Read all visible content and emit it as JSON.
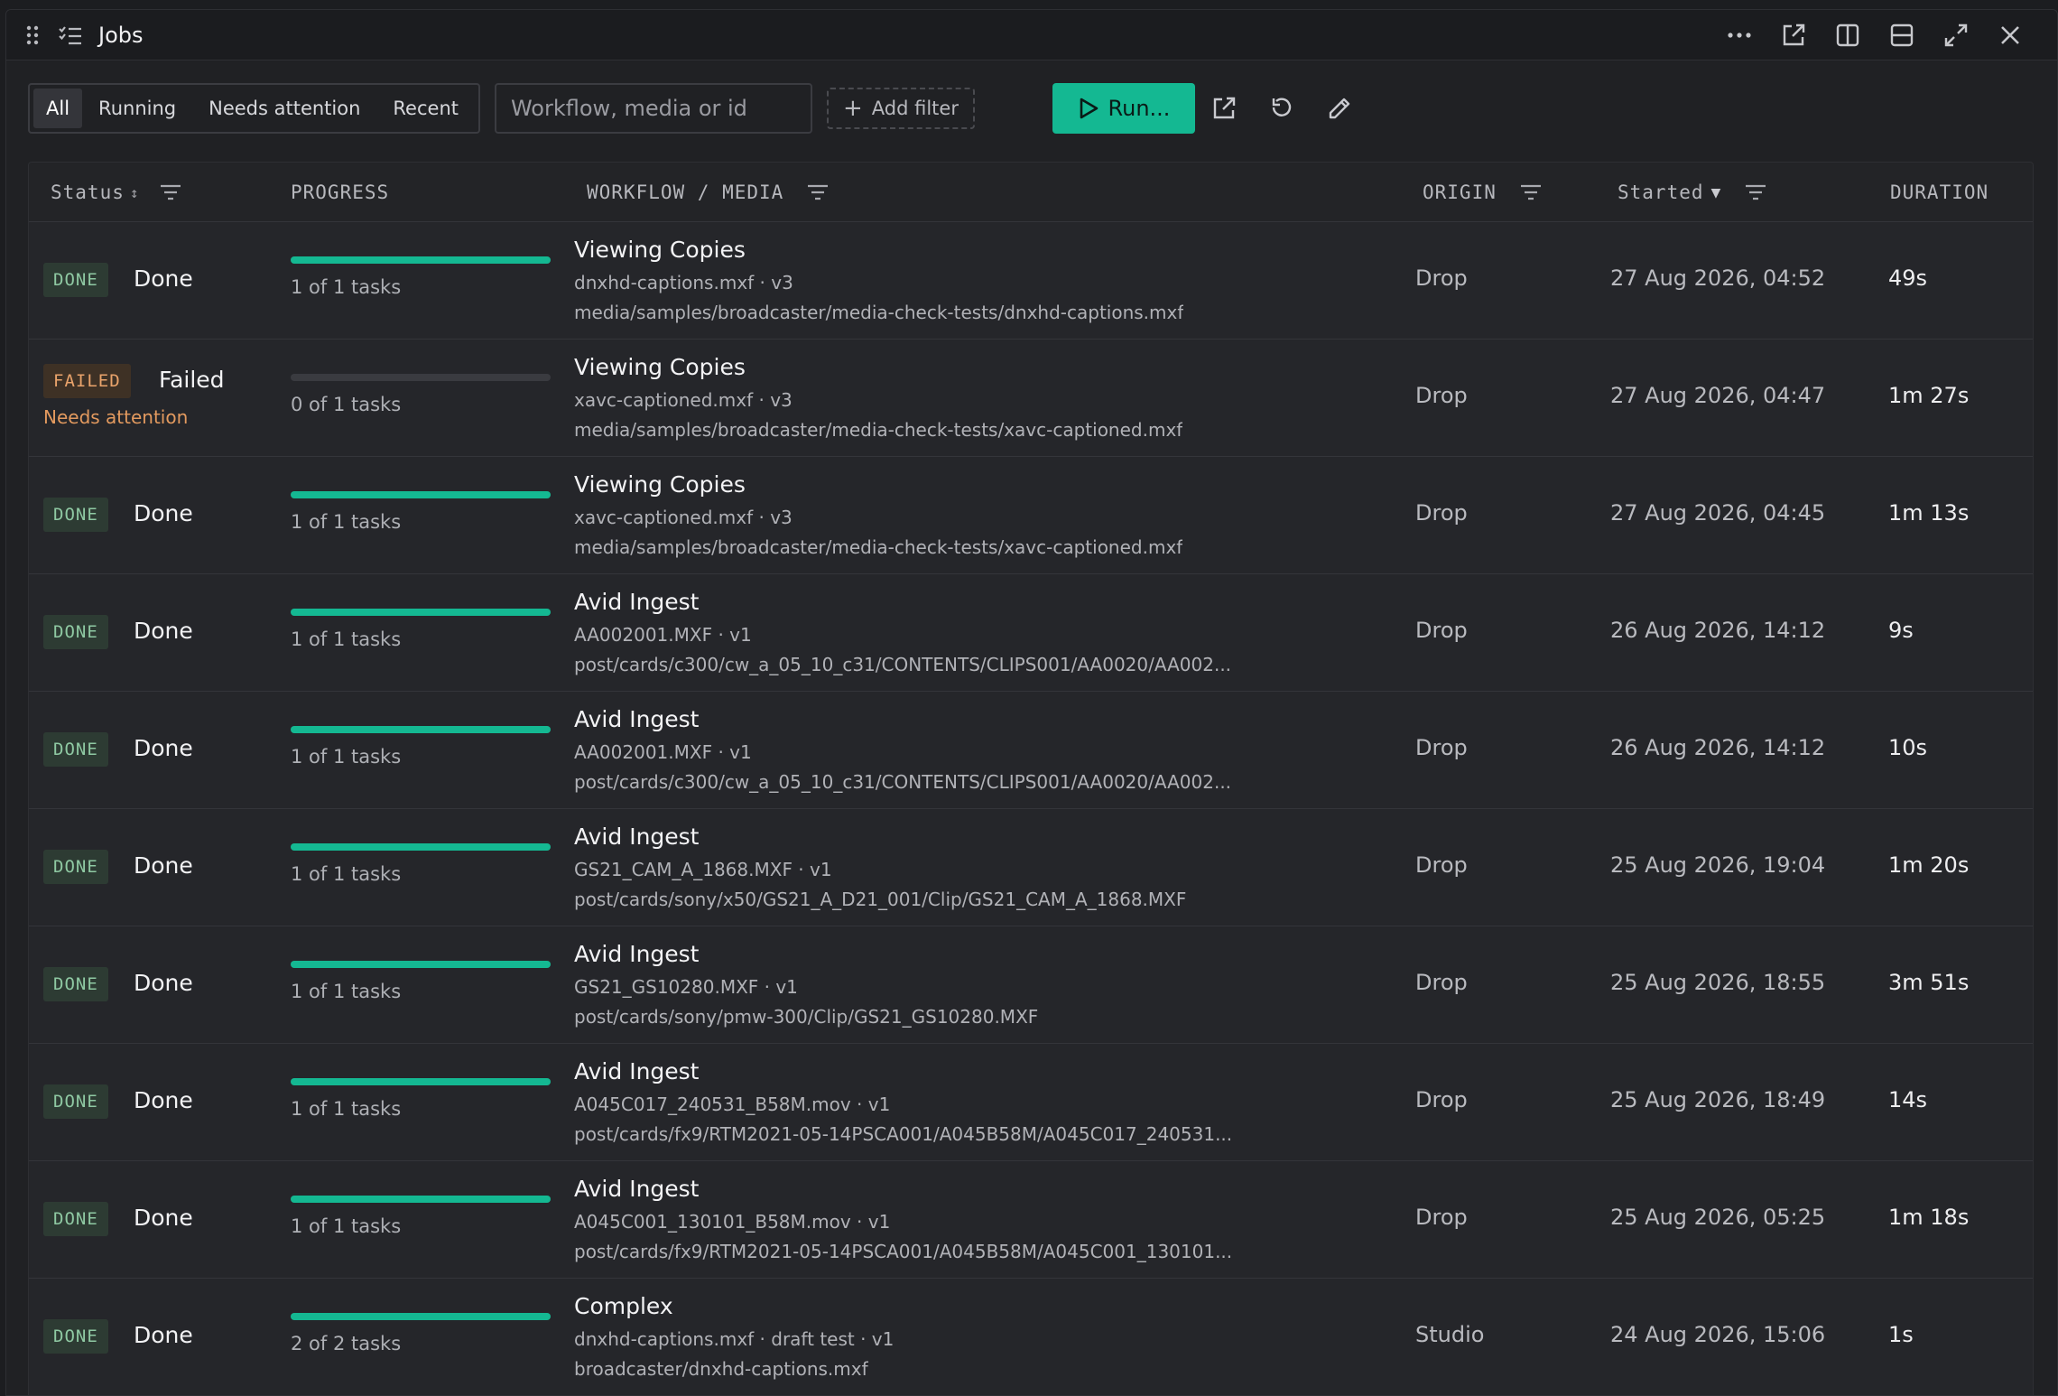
{
  "window": {
    "title": "Jobs"
  },
  "toolbar": {
    "tabs": [
      "All",
      "Running",
      "Needs attention",
      "Recent"
    ],
    "active_tab": "All",
    "search_placeholder": "Workflow, media or id",
    "add_filter_label": "Add filter",
    "run_label": "Run..."
  },
  "columns": {
    "status": "Status",
    "progress": "PROGRESS",
    "workflow_media": "WORKFLOW / MEDIA",
    "origin": "ORIGIN",
    "started": "Started",
    "duration": "DURATION"
  },
  "colors": {
    "accent": "#14b892",
    "done_badge": "#8fc9a3",
    "failed_badge": "#e9a36b",
    "attention": "#e39a5f"
  },
  "jobs": [
    {
      "badge": "DONE",
      "status": "Done",
      "progress": 1.0,
      "tasks": "1 of 1 tasks",
      "workflow": "Viewing Copies",
      "media": "dnxhd-captions.mxf · v3",
      "path": "media/samples/broadcaster/media-check-tests/dnxhd-captions.mxf",
      "origin": "Drop",
      "started": "27 Aug 2026, 04:52",
      "duration": "49s"
    },
    {
      "badge": "FAILED",
      "status": "Failed",
      "attention": "Needs attention",
      "progress": 0.0,
      "tasks": "0 of 1 tasks",
      "workflow": "Viewing Copies",
      "media": "xavc-captioned.mxf · v3",
      "path": "media/samples/broadcaster/media-check-tests/xavc-captioned.mxf",
      "origin": "Drop",
      "started": "27 Aug 2026, 04:47",
      "duration": "1m 27s"
    },
    {
      "badge": "DONE",
      "status": "Done",
      "progress": 1.0,
      "tasks": "1 of 1 tasks",
      "workflow": "Viewing Copies",
      "media": "xavc-captioned.mxf · v3",
      "path": "media/samples/broadcaster/media-check-tests/xavc-captioned.mxf",
      "origin": "Drop",
      "started": "27 Aug 2026, 04:45",
      "duration": "1m 13s"
    },
    {
      "badge": "DONE",
      "status": "Done",
      "progress": 1.0,
      "tasks": "1 of 1 tasks",
      "workflow": "Avid Ingest",
      "media": "AA002001.MXF · v1",
      "path": "post/cards/c300/cw_a_05_10_c31/CONTENTS/CLIPS001/AA0020/AA002...",
      "origin": "Drop",
      "started": "26 Aug 2026, 14:12",
      "duration": "9s"
    },
    {
      "badge": "DONE",
      "status": "Done",
      "progress": 1.0,
      "tasks": "1 of 1 tasks",
      "workflow": "Avid Ingest",
      "media": "AA002001.MXF · v1",
      "path": "post/cards/c300/cw_a_05_10_c31/CONTENTS/CLIPS001/AA0020/AA002...",
      "origin": "Drop",
      "started": "26 Aug 2026, 14:12",
      "duration": "10s"
    },
    {
      "badge": "DONE",
      "status": "Done",
      "progress": 1.0,
      "tasks": "1 of 1 tasks",
      "workflow": "Avid Ingest",
      "media": "GS21_CAM_A_1868.MXF · v1",
      "path": "post/cards/sony/x50/GS21_A_D21_001/Clip/GS21_CAM_A_1868.MXF",
      "origin": "Drop",
      "started": "25 Aug 2026, 19:04",
      "duration": "1m 20s"
    },
    {
      "badge": "DONE",
      "status": "Done",
      "progress": 1.0,
      "tasks": "1 of 1 tasks",
      "workflow": "Avid Ingest",
      "media": "GS21_GS10280.MXF · v1",
      "path": "post/cards/sony/pmw-300/Clip/GS21_GS10280.MXF",
      "origin": "Drop",
      "started": "25 Aug 2026, 18:55",
      "duration": "3m 51s"
    },
    {
      "badge": "DONE",
      "status": "Done",
      "progress": 1.0,
      "tasks": "1 of 1 tasks",
      "workflow": "Avid Ingest",
      "media": "A045C017_240531_B58M.mov · v1",
      "path": "post/cards/fx9/RTM2021-05-14PSCA001/A045B58M/A045C017_240531...",
      "origin": "Drop",
      "started": "25 Aug 2026, 18:49",
      "duration": "14s"
    },
    {
      "badge": "DONE",
      "status": "Done",
      "progress": 1.0,
      "tasks": "1 of 1 tasks",
      "workflow": "Avid Ingest",
      "media": "A045C001_130101_B58M.mov · v1",
      "path": "post/cards/fx9/RTM2021-05-14PSCA001/A045B58M/A045C001_130101...",
      "origin": "Drop",
      "started": "25 Aug 2026, 05:25",
      "duration": "1m 18s"
    },
    {
      "badge": "DONE",
      "status": "Done",
      "progress": 1.0,
      "tasks": "2 of 2 tasks",
      "workflow": "Complex",
      "media": "dnxhd-captions.mxf · draft test · v1",
      "path": "broadcaster/dnxhd-captions.mxf",
      "origin": "Studio",
      "started": "24 Aug 2026, 15:06",
      "duration": "1s"
    }
  ]
}
